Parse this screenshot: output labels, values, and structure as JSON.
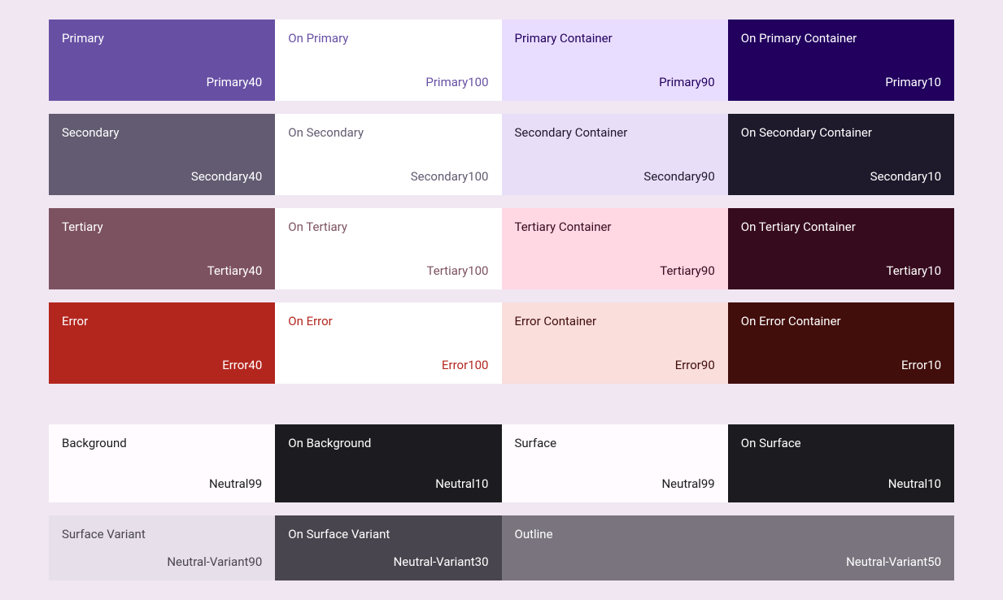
{
  "rows": [
    [
      {
        "role": "Primary",
        "token": "Primary40",
        "bg": "#6750a4",
        "fg": "#ffffff"
      },
      {
        "role": "On Primary",
        "token": "Primary100",
        "bg": "#ffffff",
        "fg": "#6750a4"
      },
      {
        "role": "Primary Container",
        "token": "Primary90",
        "bg": "#e9ddff",
        "fg": "#21005d"
      },
      {
        "role": "On Primary Container",
        "token": "Primary10",
        "bg": "#21005e",
        "fg": "#ffffff"
      }
    ],
    [
      {
        "role": "Secondary",
        "token": "Secondary40",
        "bg": "#625b71",
        "fg": "#ffffff"
      },
      {
        "role": "On Secondary",
        "token": "Secondary100",
        "bg": "#ffffff",
        "fg": "#625b71"
      },
      {
        "role": "Secondary Container",
        "token": "Secondary90",
        "bg": "#e8def8",
        "fg": "#1e192b"
      },
      {
        "role": "On Secondary Container",
        "token": "Secondary10",
        "bg": "#1e192b",
        "fg": "#ffffff"
      }
    ],
    [
      {
        "role": "Tertiary",
        "token": "Tertiary40",
        "bg": "#7d5260",
        "fg": "#ffffff"
      },
      {
        "role": "On Tertiary",
        "token": "Tertiary100",
        "bg": "#ffffff",
        "fg": "#7d5260"
      },
      {
        "role": "Tertiary Container",
        "token": "Tertiary90",
        "bg": "#ffd8e4",
        "fg": "#370b1e"
      },
      {
        "role": "On Tertiary Container",
        "token": "Tertiary10",
        "bg": "#370b1e",
        "fg": "#ffffff"
      }
    ],
    [
      {
        "role": "Error",
        "token": "Error40",
        "bg": "#b3261e",
        "fg": "#ffffff"
      },
      {
        "role": "On Error",
        "token": "Error100",
        "bg": "#ffffff",
        "fg": "#b3261e"
      },
      {
        "role": "Error Container",
        "token": "Error90",
        "bg": "#f9dedc",
        "fg": "#410e0b"
      },
      {
        "role": "On Error Container",
        "token": "Error10",
        "bg": "#410e0b",
        "fg": "#ffffff"
      }
    ]
  ],
  "neutral_row": [
    {
      "role": "Background",
      "token": "Neutral99",
      "bg": "#fffbfe",
      "fg": "#1c1b1f"
    },
    {
      "role": "On Background",
      "token": "Neutral10",
      "bg": "#1c1b1f",
      "fg": "#ffffff"
    },
    {
      "role": "Surface",
      "token": "Neutral99",
      "bg": "#fffbfe",
      "fg": "#1c1b1f"
    },
    {
      "role": "On Surface",
      "token": "Neutral10",
      "bg": "#1c1b1f",
      "fg": "#ffffff"
    }
  ],
  "variant_row": [
    {
      "role": "Surface Variant",
      "token": "Neutral-Variant90",
      "bg": "#e7e0eb",
      "fg": "#49454e",
      "span": 1
    },
    {
      "role": "On Surface Variant",
      "token": "Neutral-Variant30",
      "bg": "#49454e",
      "fg": "#ffffff",
      "span": 1
    },
    {
      "role": "Outline",
      "token": "Neutral-Variant50",
      "bg": "#79747e",
      "fg": "#ffffff",
      "span": 2
    }
  ]
}
